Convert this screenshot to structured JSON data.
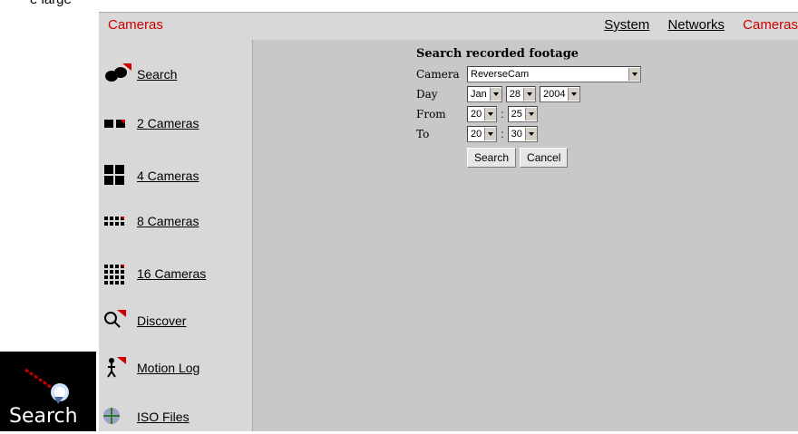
{
  "top_clip_text": "e large",
  "header": {
    "title": "Cameras",
    "nav": [
      {
        "label": "System"
      },
      {
        "label": "Networks"
      },
      {
        "label": "Cameras",
        "active": true
      }
    ]
  },
  "sidebar": {
    "items": [
      {
        "label": "Search",
        "icon": "binoculars-icon"
      },
      {
        "label": "2 Cameras",
        "icon": "two-squares-icon"
      },
      {
        "label": "4 Cameras",
        "icon": "four-grid-icon"
      },
      {
        "label": "8 Cameras",
        "icon": "eight-grid-icon"
      },
      {
        "label": "16 Cameras",
        "icon": "sixteen-grid-icon"
      },
      {
        "label": "Discover",
        "icon": "magnifier-icon"
      },
      {
        "label": "Motion Log",
        "icon": "running-person-icon"
      },
      {
        "label": "ISO Files",
        "icon": "disc-icon"
      }
    ]
  },
  "form": {
    "title": "Search recorded footage",
    "camera_label": "Camera",
    "camera_value": "ReverseCam",
    "day_label": "Day",
    "day_month": "Jan",
    "day_day": "28",
    "day_year": "2004",
    "from_label": "From",
    "from_hour": "20",
    "from_min": "25",
    "to_label": "To",
    "to_hour": "20",
    "to_min": "30",
    "colon": ":",
    "search_button": "Search",
    "cancel_button": "Cancel"
  },
  "logo": {
    "word": "Search"
  },
  "colors": {
    "accent": "#d00000",
    "panel": "#d8d8d8",
    "main_bg": "#c8c8c8"
  }
}
